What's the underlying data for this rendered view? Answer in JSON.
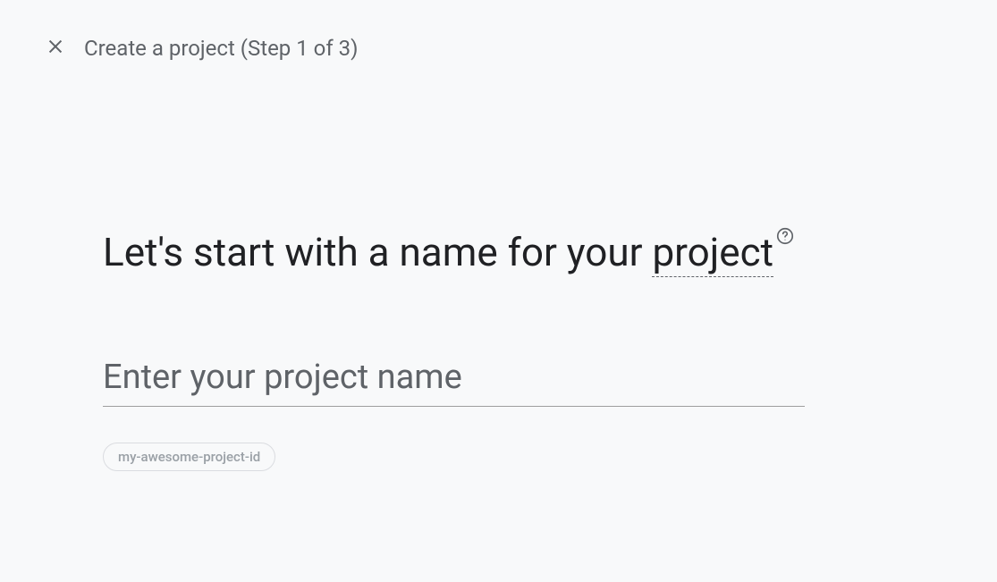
{
  "header": {
    "title": "Create a project (Step 1 of 3)"
  },
  "main": {
    "heading_prefix": "Let's start with a name for your ",
    "heading_decorated": "project"
  },
  "form": {
    "project_name_placeholder": "Enter your project name",
    "project_name_value": "",
    "project_id_chip": "my-awesome-project-id"
  }
}
